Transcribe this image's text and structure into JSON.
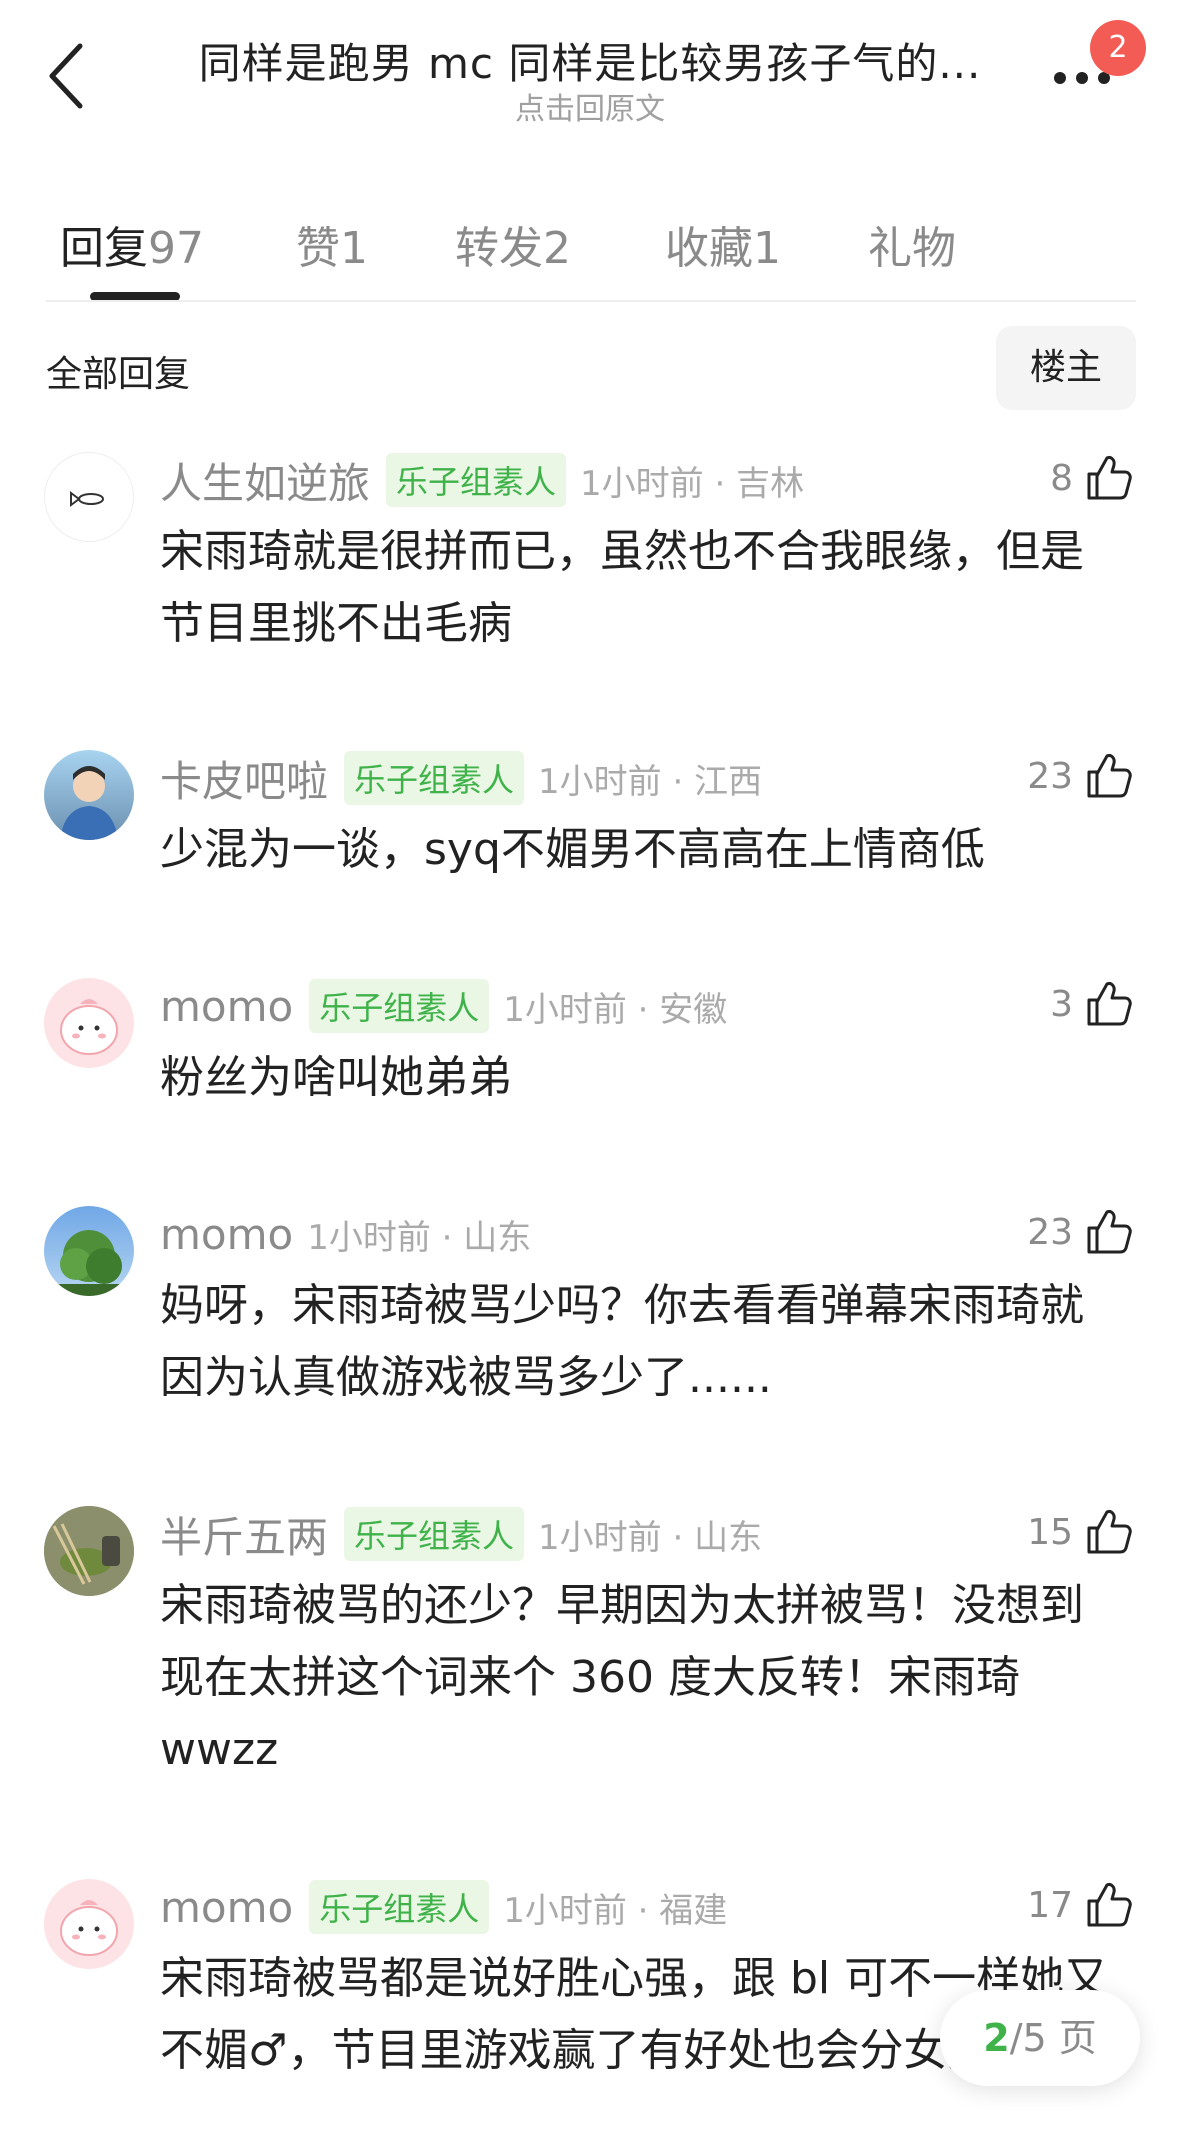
{
  "header": {
    "title": "同样是跑男 mc 同样是比较男孩子气的...",
    "subtitle": "点击回原文",
    "badge_count": "2"
  },
  "tabs": [
    {
      "label": "回复",
      "count": "97"
    },
    {
      "label": "赞",
      "count": "1"
    },
    {
      "label": "转发",
      "count": "2"
    },
    {
      "label": "收藏",
      "count": "1"
    },
    {
      "label": "礼物",
      "count": ""
    }
  ],
  "filter": {
    "section_title": "全部回复",
    "owner_button": "楼主"
  },
  "comments": [
    {
      "username": "人生如逆旅",
      "tag": "乐子组素人",
      "time": "1小时前 · 吉林",
      "likes": "8",
      "text": "宋雨琦就是很拼而已，虽然也不合我眼缘，但是节目里挑不出毛病",
      "avatar": "fish-sketch"
    },
    {
      "username": "卡皮吧啦",
      "tag": "乐子组素人",
      "time": "1小时前 · 江西",
      "likes": "23",
      "text": "少混为一谈，syq不媚男不高高在上情商低",
      "avatar": "person-photo"
    },
    {
      "username": "momo",
      "tag": "乐子组素人",
      "time": "1小时前 · 安徽",
      "likes": "3",
      "text": "粉丝为啥叫她弟弟",
      "avatar": "pink-cartoon"
    },
    {
      "username": "momo",
      "tag": "",
      "time": "1小时前 · 山东",
      "likes": "23",
      "text": "妈呀，宋雨琦被骂少吗？你去看看弹幕宋雨琦就因为认真做游戏被骂多少了......",
      "avatar": "tree-photo"
    },
    {
      "username": "半斤五两",
      "tag": "乐子组素人",
      "time": "1小时前 · 山东",
      "likes": "15",
      "text": "宋雨琦被骂的还少？早期因为太拼被骂！没想到现在太拼这个词来个 360 度大反转！宋雨琦wwzz",
      "avatar": "tea-photo"
    },
    {
      "username": "momo",
      "tag": "乐子组素人",
      "time": "1小时前 · 福建",
      "likes": "17",
      "text": "宋雨琦被骂都是说好胜心强，跟 bl 可不一样她又不媚♂，节目里游戏赢了有好处也会分女嘉宾",
      "avatar": "pink-cartoon"
    }
  ],
  "pager": {
    "current": "2",
    "total_label": "/5 页"
  }
}
